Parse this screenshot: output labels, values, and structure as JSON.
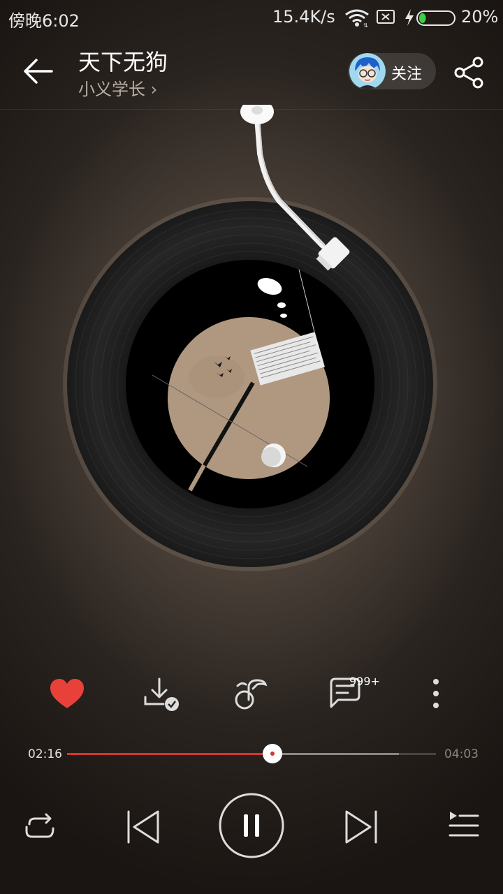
{
  "status_bar": {
    "time": "傍晚6:02",
    "network_speed": "15.4K/s",
    "battery": "20%",
    "battery_level": 0.2
  },
  "header": {
    "title": "天下无狗",
    "artist": "小义学长 ›",
    "follow_label": "关注"
  },
  "actions": {
    "comment_count": "999+"
  },
  "player": {
    "current_time": "02:16",
    "total_time": "04:03",
    "progress": 0.557,
    "buffered": 0.9
  },
  "colors": {
    "accent": "#d6352d",
    "heart": "#e8413a"
  },
  "icons": [
    "back-icon",
    "share-icon",
    "heart-icon",
    "download-done-icon",
    "music-note-icon",
    "comment-icon",
    "more-icon",
    "repeat-icon",
    "previous-icon",
    "pause-icon",
    "next-icon",
    "playlist-icon"
  ]
}
